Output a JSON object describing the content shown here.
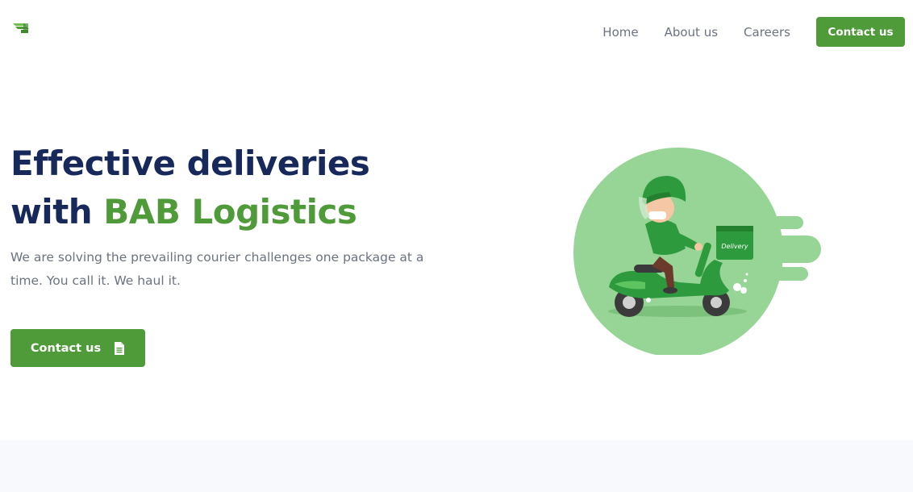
{
  "nav": {
    "logo_icon": "bab-logo-icon",
    "links": [
      {
        "label": "Home"
      },
      {
        "label": "About us"
      },
      {
        "label": "Careers"
      }
    ],
    "cta_label": "Contact us"
  },
  "hero": {
    "title_line1": "Effective deliveries",
    "title_line2_prefix": "with ",
    "title_line2_accent": "BAB Logistics",
    "subtitle": "We are solving the prevailing courier challenges one package at a time. You call it. We haul it.",
    "cta_label": "Contact us",
    "cta_icon": "document-icon",
    "illustration": "delivery-scooter-illustration",
    "box_lettering": "Delivery"
  },
  "colors": {
    "brand_green": "#4f9a39",
    "title_navy": "#16295a",
    "muted_text": "#6b7280",
    "circle_green": "#97d597"
  }
}
